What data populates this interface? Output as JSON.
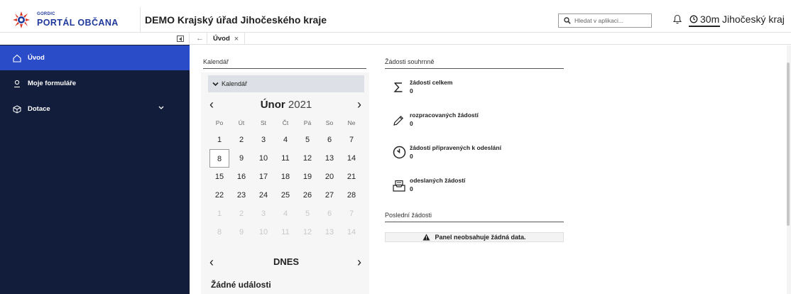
{
  "brand": {
    "small": "GORDIC",
    "name": "PORTÁL OBČANA"
  },
  "header": {
    "title": "DEMO Krajský úřad Jihočeského kraje",
    "search_placeholder": "Hledat v aplikaci...",
    "timer": "30m",
    "region": "Jihočeský kraj"
  },
  "sidebar": {
    "items": [
      {
        "label": "Úvod",
        "icon": "home-icon",
        "active": true
      },
      {
        "label": "Moje formuláře",
        "icon": "user-icon"
      },
      {
        "label": "Dotace",
        "icon": "cube-icon",
        "expandable": true
      }
    ]
  },
  "tabs": [
    {
      "label": "Úvod"
    }
  ],
  "calendar": {
    "section_label": "Kalendář",
    "header": "Kalendář",
    "month": "Únor",
    "year": "2021",
    "weekdays": [
      "Po",
      "Út",
      "St",
      "Čt",
      "Pá",
      "So",
      "Ne"
    ],
    "weeks": [
      [
        "1",
        "2",
        "3",
        "4",
        "5",
        "6",
        "7"
      ],
      [
        "8",
        "9",
        "10",
        "11",
        "12",
        "13",
        "14"
      ],
      [
        "15",
        "16",
        "17",
        "18",
        "19",
        "20",
        "21"
      ],
      [
        "22",
        "23",
        "24",
        "25",
        "26",
        "27",
        "28"
      ],
      [
        "1",
        "2",
        "3",
        "4",
        "5",
        "6",
        "7"
      ],
      [
        "8",
        "9",
        "10",
        "11",
        "12",
        "13",
        "14"
      ]
    ],
    "today_label": "DNES",
    "no_events": "Žádné události"
  },
  "summary": {
    "section_label": "Žádosti souhrnně",
    "stats": [
      {
        "label": "žádostí celkem",
        "value": "0",
        "icon": "sigma-icon"
      },
      {
        "label": "rozpracovaných žádostí",
        "value": "0",
        "icon": "pencil-icon"
      },
      {
        "label": "žádostí připravených k odeslání",
        "value": "0",
        "icon": "clock-icon"
      },
      {
        "label": "odeslaných žádostí",
        "value": "0",
        "icon": "inbox-icon"
      }
    ]
  },
  "recent": {
    "section_label": "Poslední žádosti",
    "empty_message": "Panel neobsahuje žádná data."
  },
  "colors": {
    "sidebar_bg": "#121d3b",
    "accent": "#2b4cc9",
    "brand": "#1f3a9a"
  }
}
